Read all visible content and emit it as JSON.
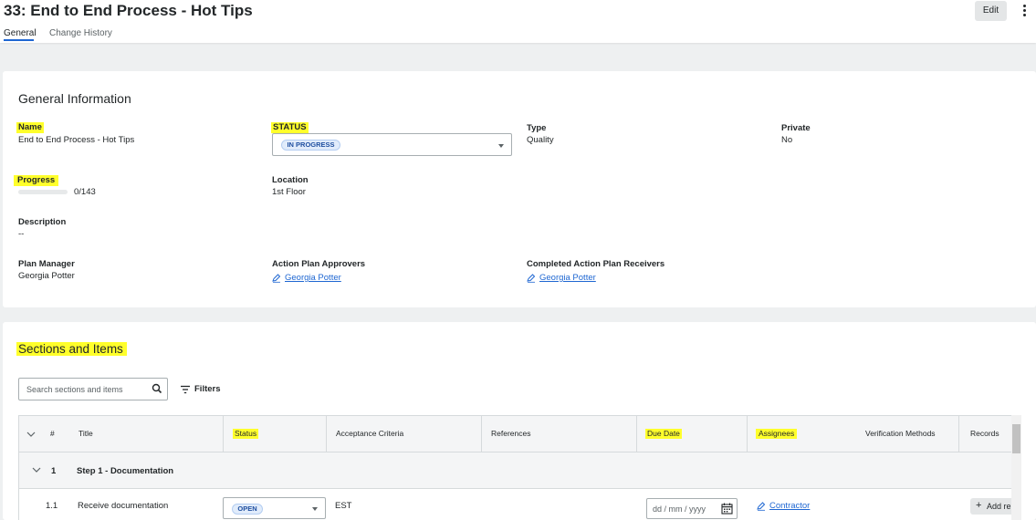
{
  "header": {
    "title": "33: End to End Process - Hot Tips",
    "tabs": [
      {
        "label": "General",
        "active": true
      },
      {
        "label": "Change History",
        "active": false
      }
    ],
    "edit_label": "Edit",
    "more_icon": "kebab-menu-icon"
  },
  "general": {
    "heading": "General Information",
    "name": {
      "label": "Name",
      "value": "End to End Process - Hot Tips"
    },
    "status": {
      "label": "STATUS",
      "value": "IN PROGRESS"
    },
    "type": {
      "label": "Type",
      "value": "Quality"
    },
    "private": {
      "label": "Private",
      "value": "No"
    },
    "progress": {
      "label": "Progress",
      "value": "0/143",
      "fraction": 0
    },
    "location": {
      "label": "Location",
      "value": "1st Floor"
    },
    "description": {
      "label": "Description",
      "value": "--"
    },
    "plan_manager": {
      "label": "Plan Manager",
      "value": "Georgia Potter"
    },
    "approvers": {
      "label": "Action Plan Approvers",
      "value": "Georgia Potter"
    },
    "receivers": {
      "label": "Completed Action Plan Receivers",
      "value": "Georgia Potter"
    }
  },
  "sections": {
    "heading": "Sections and Items",
    "search_placeholder": "Search sections and items",
    "filters_label": "Filters",
    "columns": [
      "#",
      "Title",
      "Status",
      "Acceptance Criteria",
      "References",
      "Due Date",
      "Assignees",
      "Verification Methods",
      "Records"
    ],
    "section_row": {
      "number": "1",
      "title": "Step 1 - Documentation"
    },
    "item_row": {
      "number": "1.1",
      "title": "Receive documentation",
      "status": "OPEN",
      "acceptance": "EST",
      "due_placeholder": "dd / mm / yyyy",
      "assignee": "Contractor",
      "records_action": "Add re"
    }
  },
  "colors": {
    "highlight": "#ffff2b",
    "link": "#1f67d2",
    "pill_bg": "#e1ecfb"
  }
}
